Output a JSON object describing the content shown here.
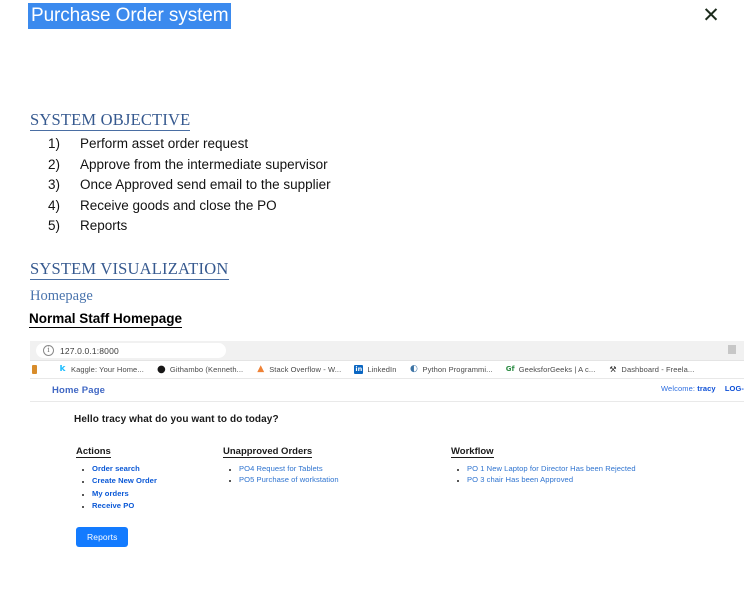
{
  "document": {
    "title": "Purchase Order system",
    "close_icon": "✕",
    "sections": {
      "objective_heading": "SYSTEM OBJECTIVE",
      "objectives": [
        {
          "num": "1)",
          "text": "Perform asset order request"
        },
        {
          "num": "2)",
          "text": "Approve from the intermediate supervisor"
        },
        {
          "num": "3)",
          "text": "Once Approved send email to the supplier"
        },
        {
          "num": "4)",
          "text": "Receive goods and close the PO"
        },
        {
          "num": "5)",
          "text": "Reports"
        }
      ],
      "visualization_heading": "SYSTEM VISUALIZATION",
      "homepage_label": "Homepage",
      "normal_staff_label": "Normal Staff Homepage"
    },
    "colors": {
      "title_highlight": "#3b8aee",
      "heading_blue": "#36598f",
      "subheading_blue": "#4a74ad"
    }
  },
  "browser": {
    "url_bar": {
      "info_icon": "i",
      "url": "127.0.0.1:8000"
    },
    "bookmarks": [
      {
        "icon": "partial-bookmark-icon",
        "label": "",
        "glyph": ""
      },
      {
        "icon": "kaggle-icon",
        "label": "Kaggle: Your Home...",
        "glyph": "k"
      },
      {
        "icon": "github-icon",
        "label": "Githambo (Kenneth...",
        "glyph": "●"
      },
      {
        "icon": "stackoverflow-icon",
        "label": "Stack Overflow - W...",
        "glyph": "▲"
      },
      {
        "icon": "linkedin-icon",
        "label": "LinkedIn",
        "glyph": "in"
      },
      {
        "icon": "python-icon",
        "label": "Python Programmi...",
        "glyph": "◐"
      },
      {
        "icon": "geeksforgeeks-icon",
        "label": "GeeksforGeeks | A c...",
        "glyph": "GfG"
      },
      {
        "icon": "dashboard-icon",
        "label": "Dashboard - Freela...",
        "glyph": "⚒"
      }
    ],
    "app": {
      "nav_brand": "Home Page",
      "welcome_label": "Welcome:",
      "username": "tracy",
      "logout_label": "LOG-",
      "greeting": "Hello tracy what do you want to do today?",
      "columns": [
        {
          "heading": "Actions",
          "style": "strong",
          "items": [
            "Order search",
            "Create New Order",
            "My orders",
            "Receive PO"
          ]
        },
        {
          "heading": "Unapproved Orders",
          "style": "plain",
          "items": [
            "PO4 Request for Tablets",
            "PO5 Purchase of workstation"
          ]
        },
        {
          "heading": "Workflow",
          "style": "plain",
          "items": [
            "PO 1 New Laptop for Director Has been Rejected",
            "PO 3 chair Has been Approved"
          ]
        }
      ],
      "reports_button": "Reports",
      "accent_color": "#137bff"
    }
  }
}
